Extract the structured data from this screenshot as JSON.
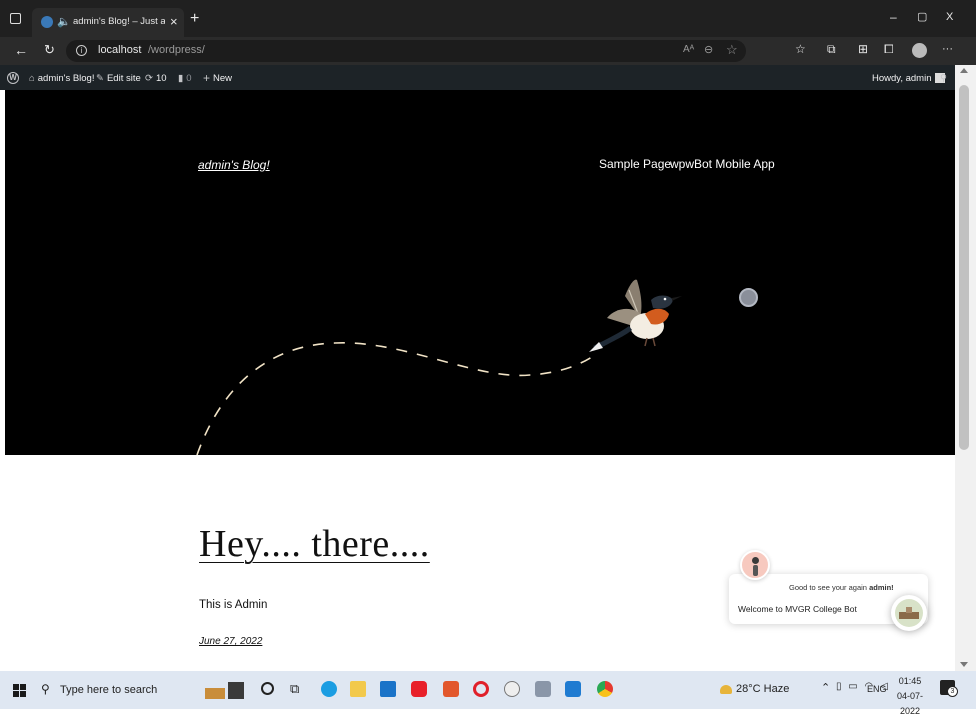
{
  "browser": {
    "tab_title": "admin's Blog! – Just anothe",
    "tab_close": "×",
    "new_tab": "+",
    "url_host": "localhost",
    "url_path": "/wordpress/",
    "window_minimize": "–",
    "window_restore": "▢",
    "window_close": "X",
    "more": "···"
  },
  "admin_bar": {
    "site_name": "admin's Blog!",
    "edit_site": "Edit site",
    "updates_count": "10",
    "comments_count": "0",
    "new_label": "New",
    "howdy": "Howdy, admin"
  },
  "site": {
    "title": "admin's Blog!",
    "nav": [
      "Sample Page",
      "wpwBot Mobile App"
    ]
  },
  "post": {
    "title": "Hey.... there....",
    "body": "This is Admin",
    "date": "June 27, 2022"
  },
  "chatbot": {
    "greeting_prefix": "Good to see your again ",
    "greeting_name": "admin!",
    "welcome": "Welcome to MVGR College Bot"
  },
  "taskbar": {
    "search_placeholder": "Type here to search",
    "weather": "28°C  Haze",
    "language": "ENG",
    "time": "01:45",
    "date": "04-07-2022",
    "notification_count": "3"
  }
}
